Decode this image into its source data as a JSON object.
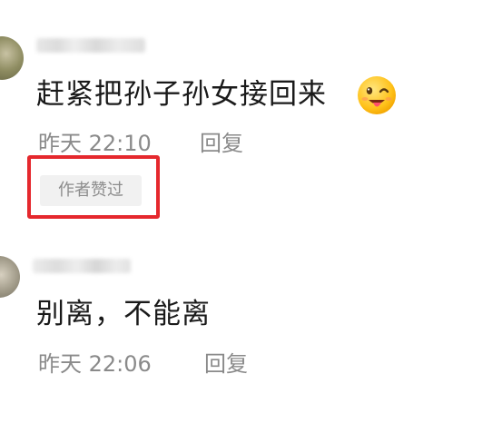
{
  "comments": [
    {
      "text": "赶紧把孙子孙女接回来",
      "emoji": "winking-tongue-emoji",
      "time": "昨天 22:10",
      "reply_label": "回复",
      "badge": "作者赞过"
    },
    {
      "text": "别离，不能离",
      "time": "昨天 22:06",
      "reply_label": "回复"
    }
  ],
  "colors": {
    "highlight_border": "#e5282d",
    "meta_text": "#8a8a8a",
    "badge_background": "#f1f1f1",
    "body_text": "#1a1a1a"
  }
}
